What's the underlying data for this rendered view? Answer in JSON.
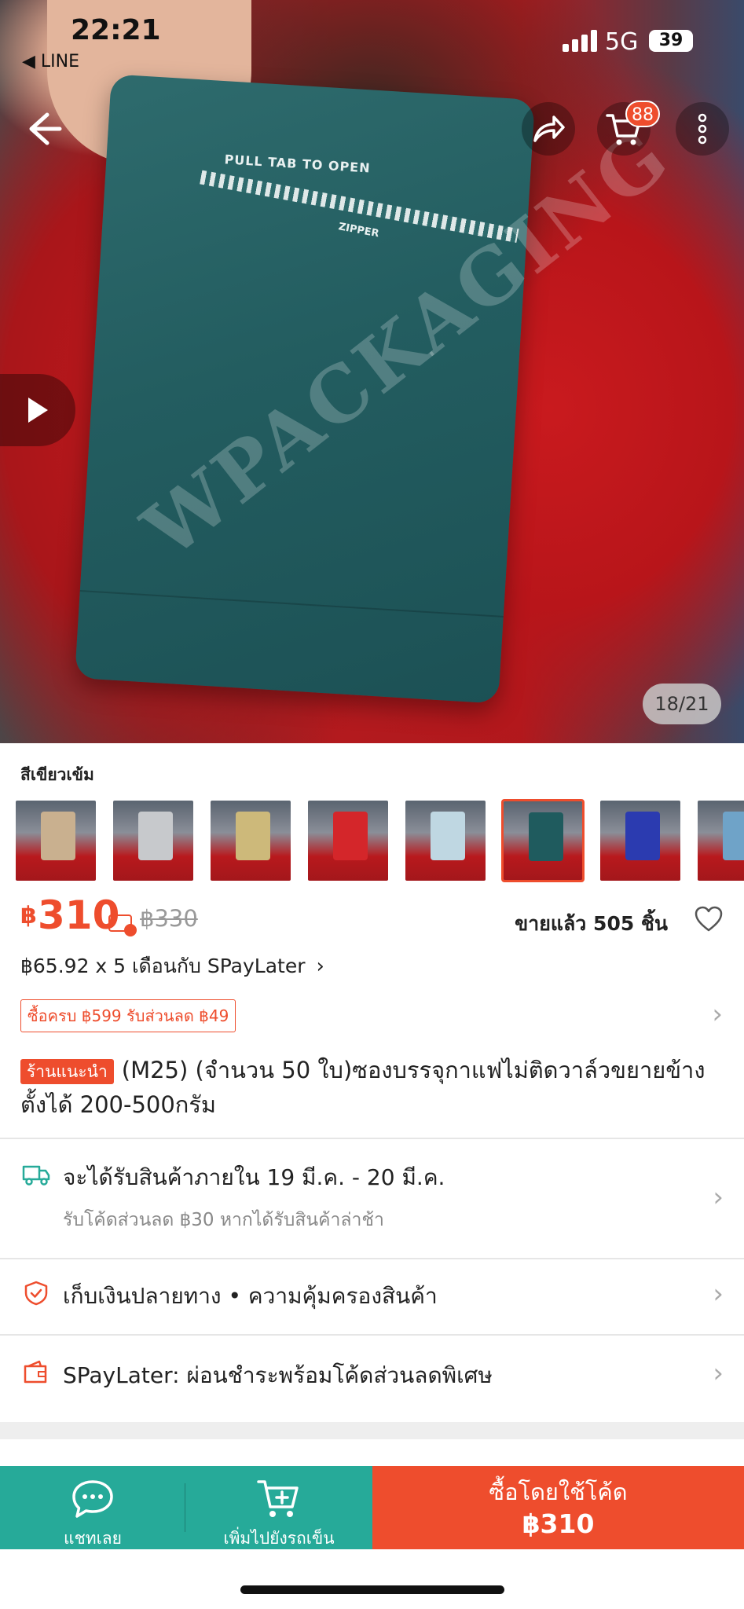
{
  "status_bar": {
    "time": "22:21",
    "back_app": "◀ LINE",
    "network": "5G",
    "battery": "39"
  },
  "gallery": {
    "cart_count": "88",
    "counter": "18/21",
    "bag_print": "PULL TAB TO OPEN",
    "zipper_print": "ZIPPER",
    "watermark": "WPACKAGING"
  },
  "variant": {
    "selected_name": "สีเขียวเข้ม",
    "thumbnail_colors": [
      "#c9b08f",
      "#c7c9cc",
      "#cdb97a",
      "#d4262a",
      "#bfd7e2",
      "#1f5b5e",
      "#2b3bb0",
      "#6fa3c8"
    ],
    "selected_index": 5
  },
  "price": {
    "currency": "฿",
    "current": "310",
    "original": "฿330",
    "sold": "ขายแล้ว 505 ชิ้น",
    "installment": "฿65.92 x 5 เดือนกับ SPayLater"
  },
  "voucher": {
    "label": "ซื้อครบ ฿599 รับส่วนลด ฿49"
  },
  "product": {
    "tag": "ร้านแนะนำ",
    "title": "(M25) (จำนวน 50 ใบ)ซองบรรจุกาแฟไม่ติดวาล์วขยายข้างตั้งได้ 200-500กรัม"
  },
  "shipping": {
    "main": "จะได้รับสินค้าภายใน 19 มี.ค. - 20 มี.ค.",
    "sub": "รับโค้ดส่วนลด ฿30 หากได้รับสินค้าล่าช้า"
  },
  "guarantee": {
    "main": "เก็บเงินปลายทาง  •  ความคุ้มครองสินค้า"
  },
  "spaylater": {
    "main": "SPayLater: ผ่อนชำระพร้อมโค้ดส่วนลดพิเศษ"
  },
  "bottom_bar": {
    "chat_label": "แชทเลย",
    "cart_label": "เพิ่มไปยังรถเข็น",
    "buy_label": "ซื้อโดยใช้โค้ด",
    "buy_price": "฿310"
  },
  "colors": {
    "brand": "#ee4d2d",
    "teal": "#26aa99"
  }
}
